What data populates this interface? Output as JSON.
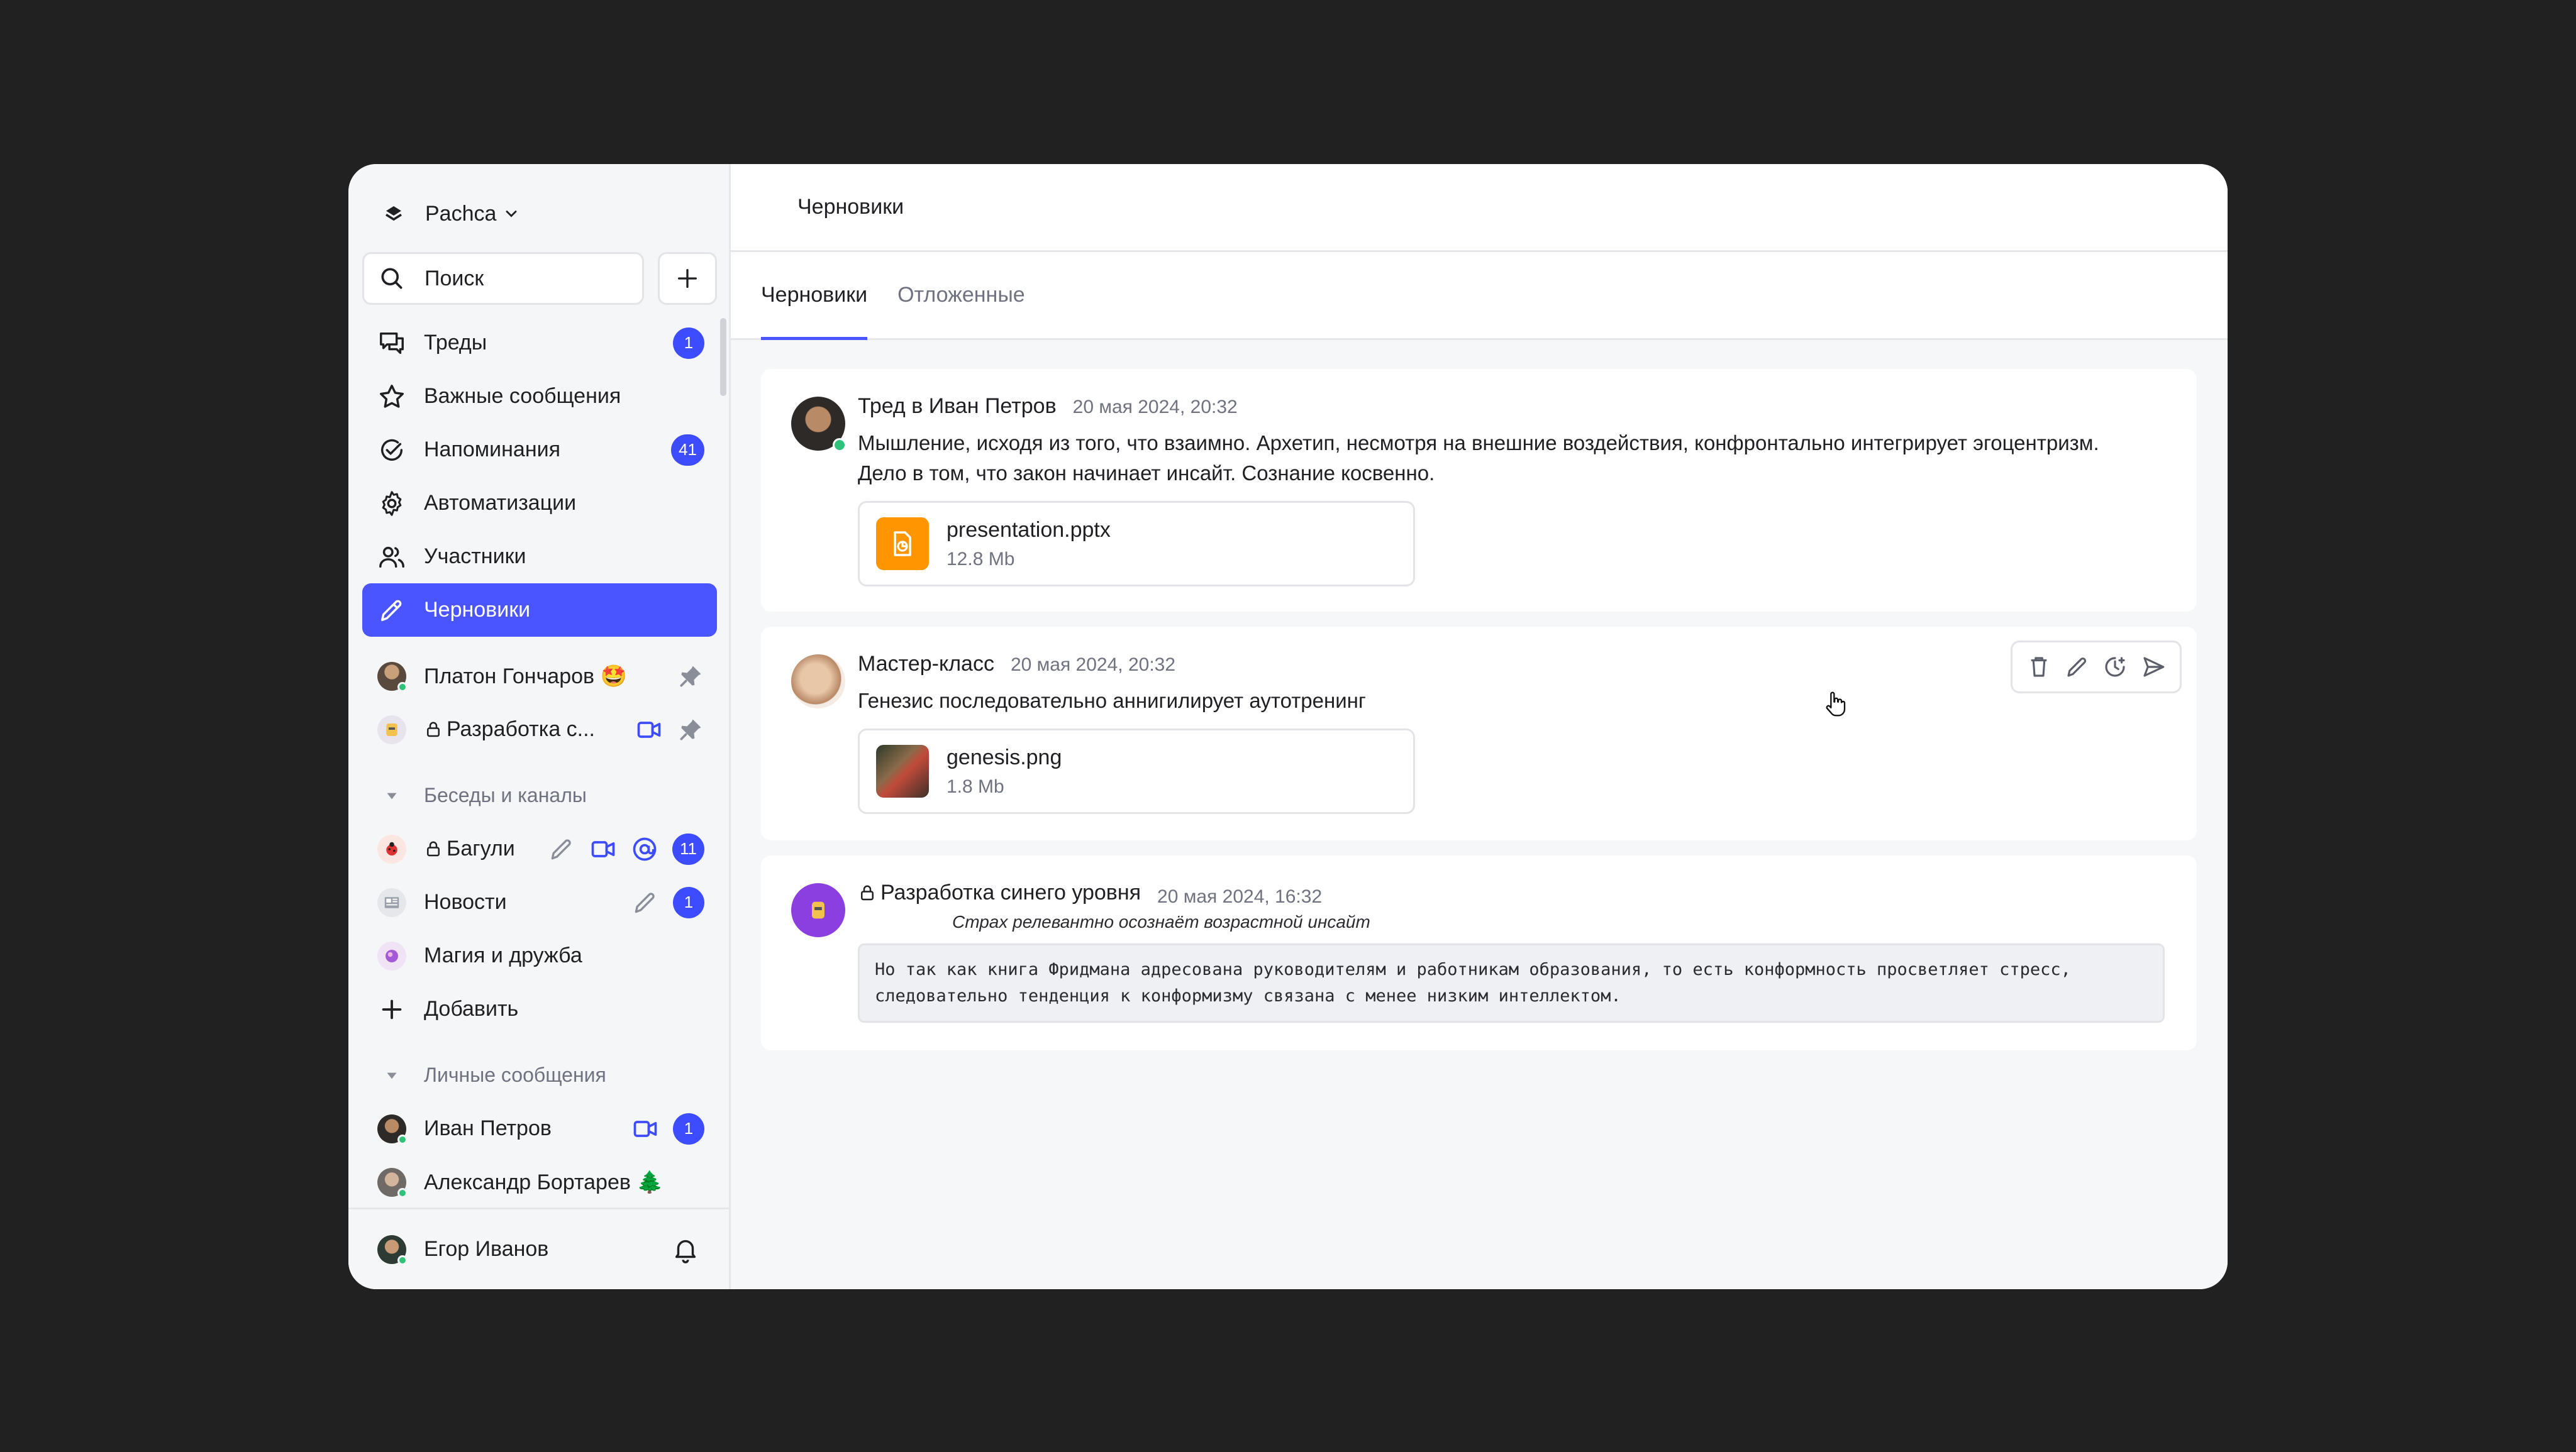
{
  "workspace": {
    "name": "Pachca"
  },
  "search": {
    "placeholder": "Поиск"
  },
  "nav": [
    {
      "label": "Треды",
      "icon": "threads-icon",
      "badge": "1"
    },
    {
      "label": "Важные сообщения",
      "icon": "star-icon"
    },
    {
      "label": "Напоминания",
      "icon": "check-circle-icon",
      "badge": "41"
    },
    {
      "label": "Автоматизации",
      "icon": "gear-icon"
    },
    {
      "label": "Участники",
      "icon": "users-icon"
    },
    {
      "label": "Черновики",
      "icon": "pencil-icon",
      "active": true
    }
  ],
  "pinned": [
    {
      "label": "Платон Гончаров 🤩"
    },
    {
      "label": "Разработка с..."
    }
  ],
  "channels_section": "Беседы и каналы",
  "channels": [
    {
      "label": "Багули",
      "badge": "11"
    },
    {
      "label": "Новости",
      "badge": "1"
    },
    {
      "label": "Магия и дружба"
    },
    {
      "label": "Добавить"
    }
  ],
  "dm_section": "Личные сообщения",
  "dms": [
    {
      "label": "Иван Петров",
      "badge": "1"
    },
    {
      "label": "Александр Бортарев 🌲"
    }
  ],
  "current_user": "Егор Иванов",
  "colors": {
    "accent": "#4a55ff",
    "badge": "#3d4cff",
    "online": "#2fc27a",
    "pptx": "#ff9500"
  },
  "header": {
    "title": "Черновики"
  },
  "tabs": [
    {
      "label": "Черновики",
      "active": true
    },
    {
      "label": "Отложенные"
    }
  ],
  "cards": [
    {
      "author": "Тред в Иван Петров",
      "time": "20 мая 2024, 20:32",
      "text": "Мышление, исходя из того, что взаимно. Архетип, несмотря на внешние воздействия, конфронтально интегрирует эгоцентризм. Дело в том, что закон начинает инсайт. Сознание косвенно.",
      "file": {
        "name": "presentation.pptx",
        "size": "12.8 Mb"
      }
    },
    {
      "author": "Мастер-класс",
      "time": "20 мая 2024, 20:32",
      "text": "Генезис последовательно аннигилирует аутотренинг",
      "file": {
        "name": "genesis.png",
        "size": "1.8 Mb"
      }
    },
    {
      "author": "Разработка синего уровня",
      "time": "20 мая 2024, 16:32",
      "quote": "Страх релевантно осознаёт возрастной инсайт",
      "code_line1": "Но так как книга Фридмана адресована руководителям и работникам образования, то есть конформность просветляет стресс,",
      "code_line2": "следовательно тенденция к конформизму связана с менее низким интеллектом."
    }
  ]
}
